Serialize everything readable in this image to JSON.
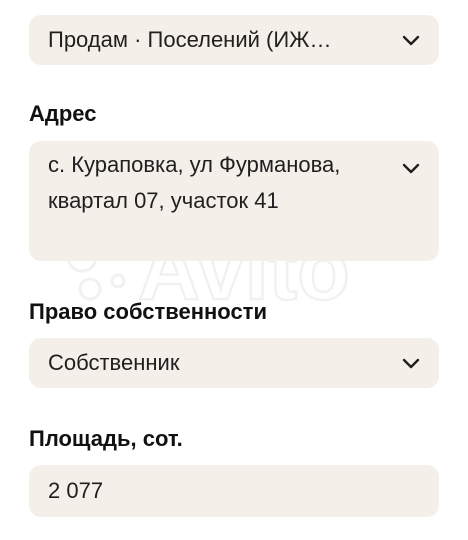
{
  "form": {
    "category": {
      "value": "Продам · Поселений (ИЖ…"
    },
    "address": {
      "label": "Адрес",
      "value": "с. Кураповка, ул Фурманова, квартал 07, участок 41"
    },
    "ownership": {
      "label": "Право собственности",
      "value": "Собственник"
    },
    "area": {
      "label": "Площадь, сот.",
      "value": "2 077"
    }
  },
  "watermark": "Avito",
  "icons": {
    "dropdown": "chevron-down-icon"
  },
  "colors": {
    "field_background": "#f4efe9",
    "text": "#1f1f1f"
  }
}
